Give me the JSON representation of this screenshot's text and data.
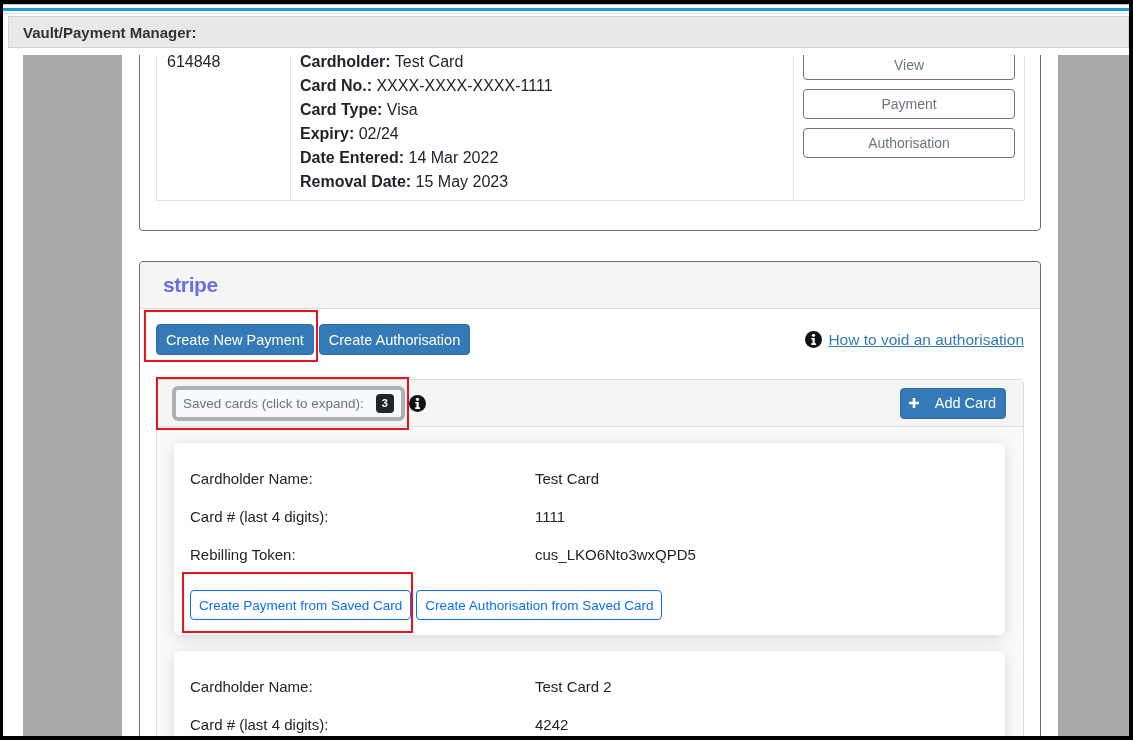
{
  "header": {
    "title": "Vault/Payment Manager:"
  },
  "vault_table": {
    "rows": [
      {
        "column_1": "614848",
        "column_2": [
          "**Cardholder:** Test Card",
          "**Card No.:** XXXX-XXXX-XXXX-1111",
          "**Card Type:** Visa",
          "**Expiry:** 02/24",
          "**Date Entered:** 14 Mar 2022",
          "**Removal Date:** 15 May 2023"
        ],
        "column_3": [
          "View",
          "Payment",
          "Authorisation"
        ]
      }
    ]
  },
  "stripe_panel": {
    "logo": "stripe",
    "actions": [
      {
        "label": "Create New Payment",
        "highlighted": true
      },
      {
        "label": "Create Authorisation",
        "highlighted": false
      }
    ],
    "help_link": "How to void an authorisation",
    "saved_cards": {
      "toggle": {
        "label": "Saved cards (click to expand):",
        "count": "3",
        "highlighted": true
      },
      "add_button": "Add Card",
      "cards": [
        {
          "rows": [
            {
              "label": "Cardholder Name:",
              "value": "Test Card"
            },
            {
              "label": "Card # (last 4 digits):",
              "value": "1111"
            },
            {
              "label": "Rebilling Token:",
              "value": "cus_LKO6Nto3wxQPD5"
            }
          ],
          "buttons": [
            {
              "label": "Create Payment from Saved Card",
              "highlighted": true
            },
            {
              "label": "Create Authorisation from Saved Card",
              "highlighted": false
            }
          ]
        },
        {
          "rows": [
            {
              "label": "Cardholder Name:",
              "value": "Test Card 2"
            },
            {
              "label": "Card # (last 4 digits):",
              "value": "4242"
            }
          ]
        }
      ]
    }
  }
}
